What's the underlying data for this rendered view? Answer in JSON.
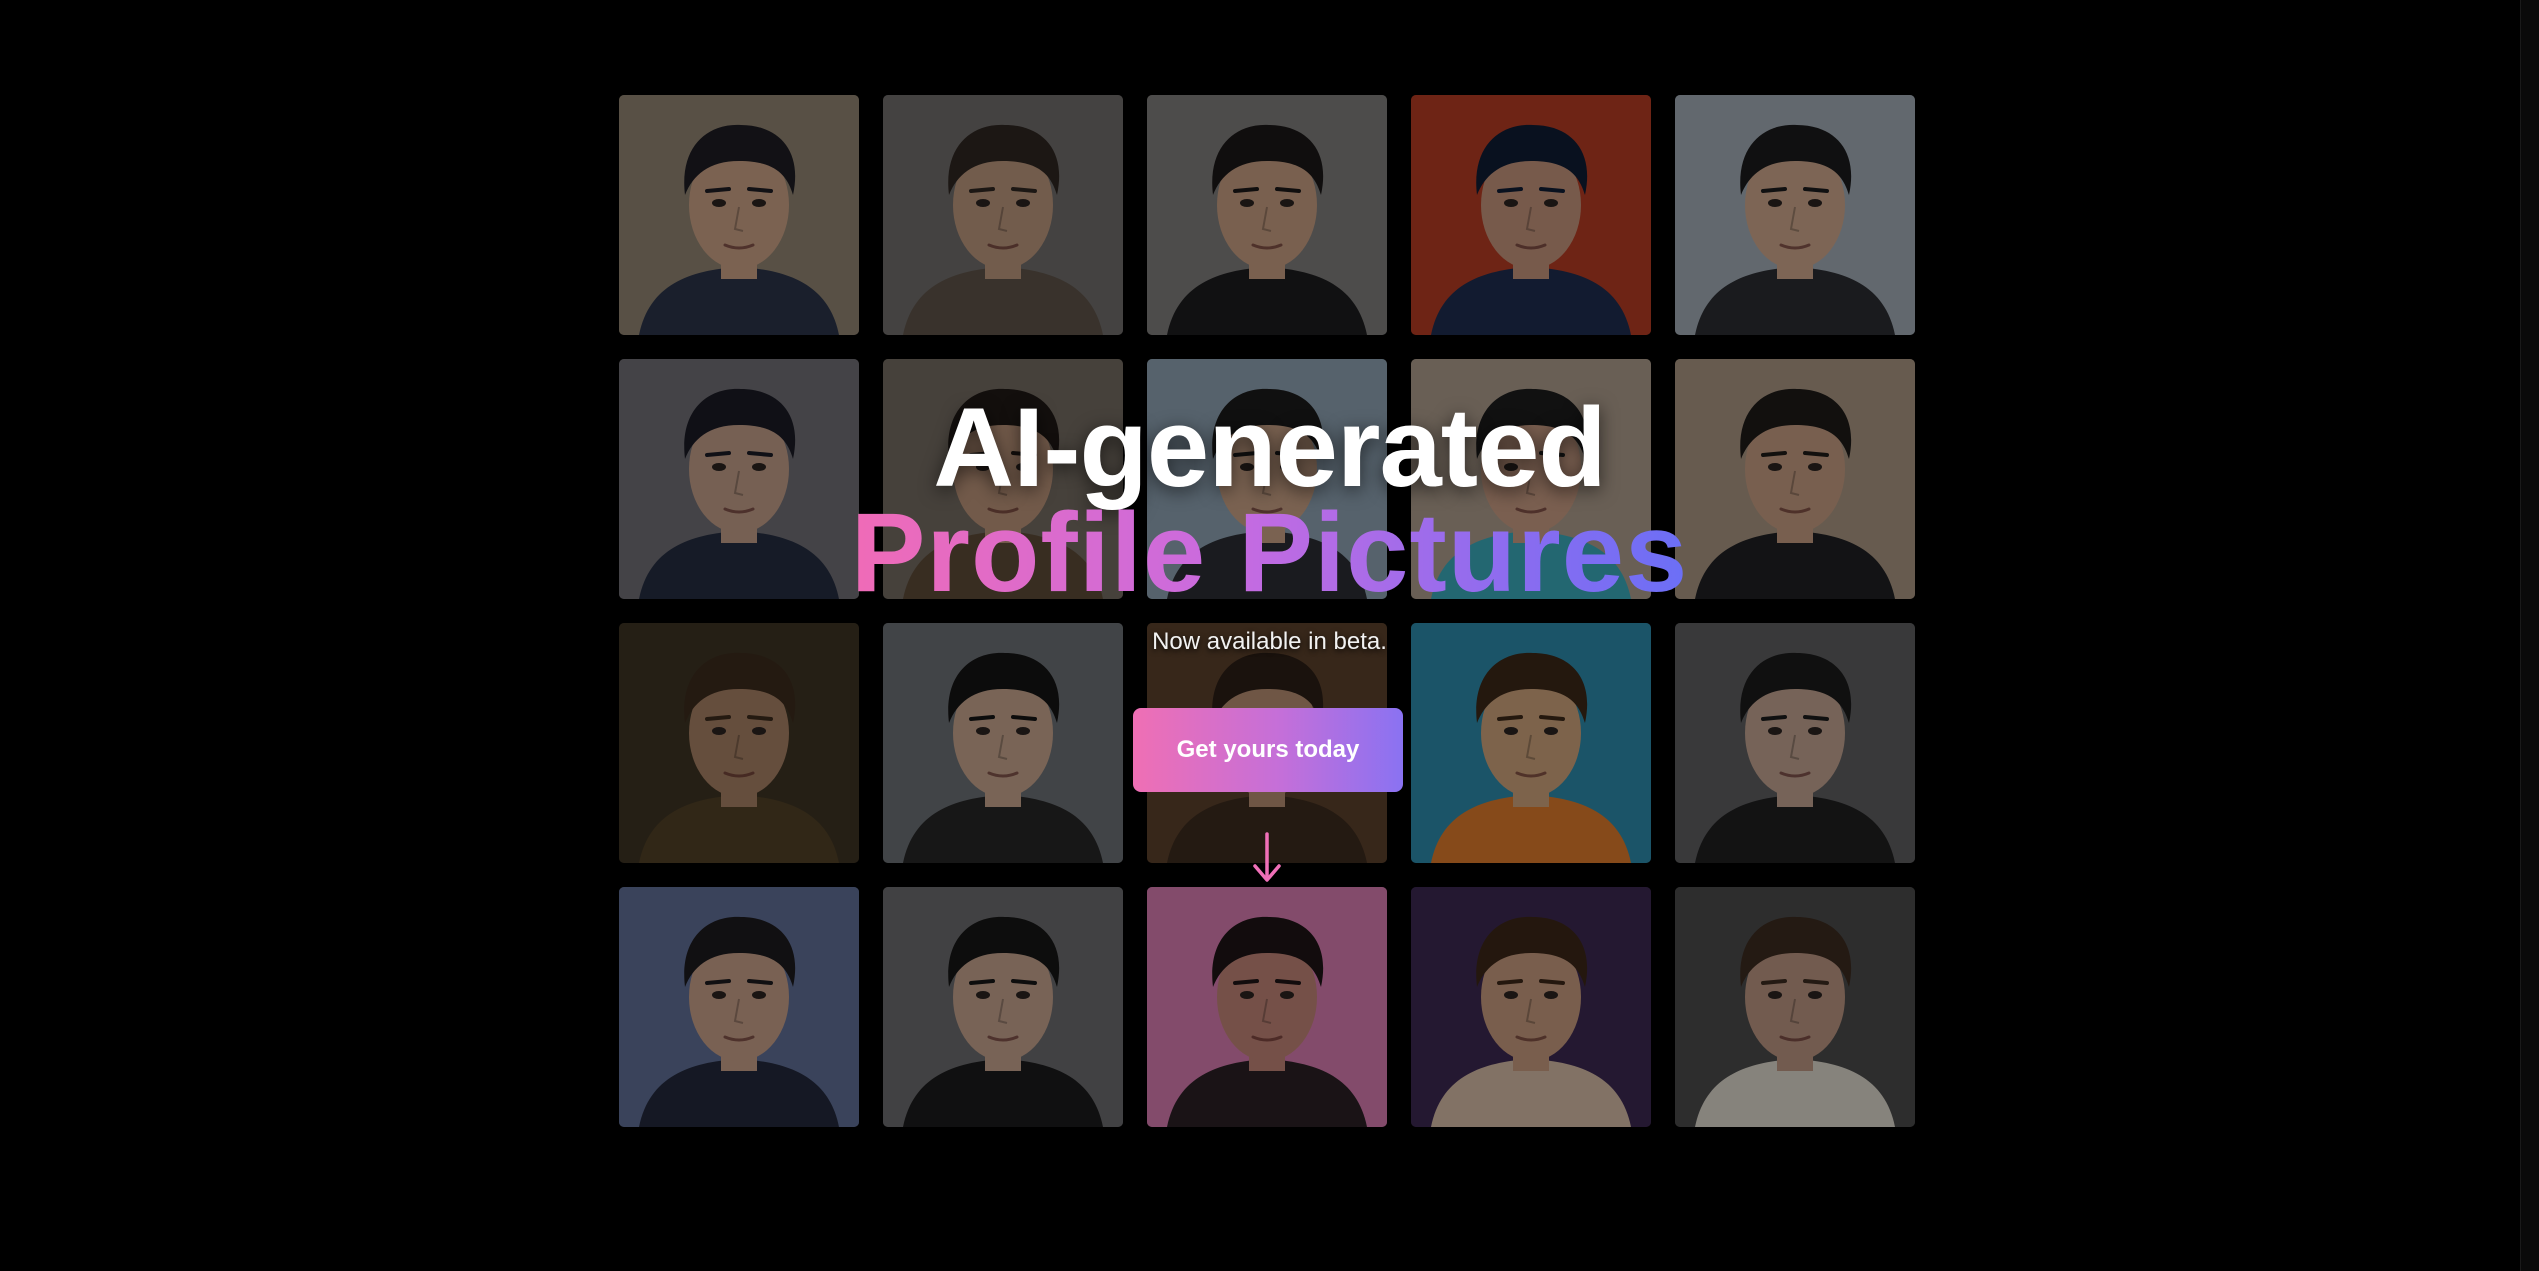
{
  "hero": {
    "line1": "AI-generated",
    "line2": "Profile Pictures",
    "subtitle": "Now available in beta.",
    "cta_label": "Get yours today"
  },
  "colors": {
    "background": "#000000",
    "gradient_start": "#ef6fb4",
    "gradient_end": "#6b6ff6",
    "arrow": "#f070b8"
  },
  "icons": {
    "scroll_down": "arrow-down-icon"
  },
  "portraits": [
    {
      "bg": "#8e8270",
      "skin": "#c79f84",
      "hair": "#1d1c22",
      "cloth": "#2b3347"
    },
    {
      "bg": "#6e6b69",
      "skin": "#b9957b",
      "hair": "#2e2621",
      "cloth": "#5c5248"
    },
    {
      "bg": "#7d7b79",
      "skin": "#c49b80",
      "hair": "#1b1818",
      "cloth": "#1c1c1e"
    },
    {
      "bg": "#b23a22",
      "skin": "#c0917a",
      "hair": "#101c33",
      "cloth": "#1d2c4e"
    },
    {
      "bg": "#9ea8b2",
      "skin": "#caa48a",
      "hair": "#1b1b1c",
      "cloth": "#2a2c31"
    },
    {
      "bg": "#6f6d73",
      "skin": "#bf9b86",
      "hair": "#1a1b25",
      "cloth": "#252d40"
    },
    {
      "bg": "#726960",
      "skin": "#b89178",
      "hair": "#1f1915",
      "cloth": "#5b4a36"
    },
    {
      "bg": "#8b9fae",
      "skin": "#c59e84",
      "hair": "#1b1a1a",
      "cloth": "#2a2d33"
    },
    {
      "bg": "#aa9a8a",
      "skin": "#c69a82",
      "hair": "#1c1c1c",
      "cloth": "#39a7b7"
    },
    {
      "bg": "#a79480",
      "skin": "#c29a80",
      "hair": "#1d1a18",
      "cloth": "#1f2022"
    },
    {
      "bg": "#3d3222",
      "skin": "#a47e63",
      "hair": "#3b2a1c",
      "cloth": "#4f4026"
    },
    {
      "bg": "#6a6e73",
      "skin": "#c3a28b",
      "hair": "#141414",
      "cloth": "#262626"
    },
    {
      "bg": "#5a3f2a",
      "skin": "#b38b70",
      "hair": "#2a1e16",
      "cloth": "#3a2a1e"
    },
    {
      "bg": "#2d88a8",
      "skin": "#caa07a",
      "hair": "#3a2718",
      "cloth": "#d8782a"
    },
    {
      "bg": "#5c5c5e",
      "skin": "#bea08e",
      "hair": "#1a1a1a",
      "cloth": "#1f1f20"
    },
    {
      "bg": "#5e6c93",
      "skin": "#c49d86",
      "hair": "#1c1a1d",
      "cloth": "#22283a"
    },
    {
      "bg": "#6a6a6c",
      "skin": "#c2a08c",
      "hair": "#151515",
      "cloth": "#1b1b1c"
    },
    {
      "bg": "#d479ad",
      "skin": "#bd8274",
      "hair": "#1d1416",
      "cloth": "#2a2025"
    },
    {
      "bg": "#3b2850",
      "skin": "#c3987c",
      "hair": "#3a2618",
      "cloth": "#d2b8a4"
    },
    {
      "bg": "#4a4a4a",
      "skin": "#b99480",
      "hair": "#3a2a20",
      "cloth": "#d8d3c9"
    }
  ]
}
